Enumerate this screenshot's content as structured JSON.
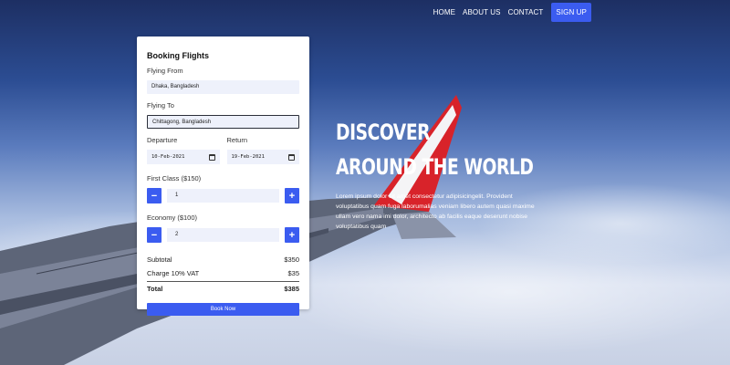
{
  "nav": {
    "items": [
      "HOME",
      "ABOUT US",
      "CONTACT"
    ],
    "signup": "SIGN UP"
  },
  "booking": {
    "title": "Booking Flights",
    "from_label": "Flying From",
    "from_value": "Dhaka, Bangladesh",
    "to_label": "Flying To",
    "to_value": "Chittagong, Bangladesh",
    "departure_label": "Departure",
    "departure_value": "10-Feb-2021",
    "return_label": "Return",
    "return_value": "19-Feb-2021",
    "first_class_label": "First Class ($150)",
    "first_class_value": "1",
    "economy_label": "Economy ($100)",
    "economy_value": "2",
    "minus": "−",
    "plus": "+",
    "subtotal_label": "Subtotal",
    "subtotal_value": "$350",
    "vat_label": "Charge 10% VAT",
    "vat_value": "$35",
    "total_label": "Total",
    "total_value": "$385",
    "book_button": "Book Now"
  },
  "hero": {
    "line1": "DISCOVER",
    "line2": "AROUND THE WORLD",
    "body": "Lorem ipsum dolor sit amet consectetur adipisicingelit. Provident voluptatibus quam fuga laborumalias veniam libero autem quasi maxime ullam vero nama imi dolor, architecto ab facilis eaque deserunt nobise voluptatibus quam"
  },
  "colors": {
    "accent": "#3b5cf0",
    "tail_red": "#d8232a"
  },
  "icons": {
    "calendar": "calendar-icon"
  }
}
